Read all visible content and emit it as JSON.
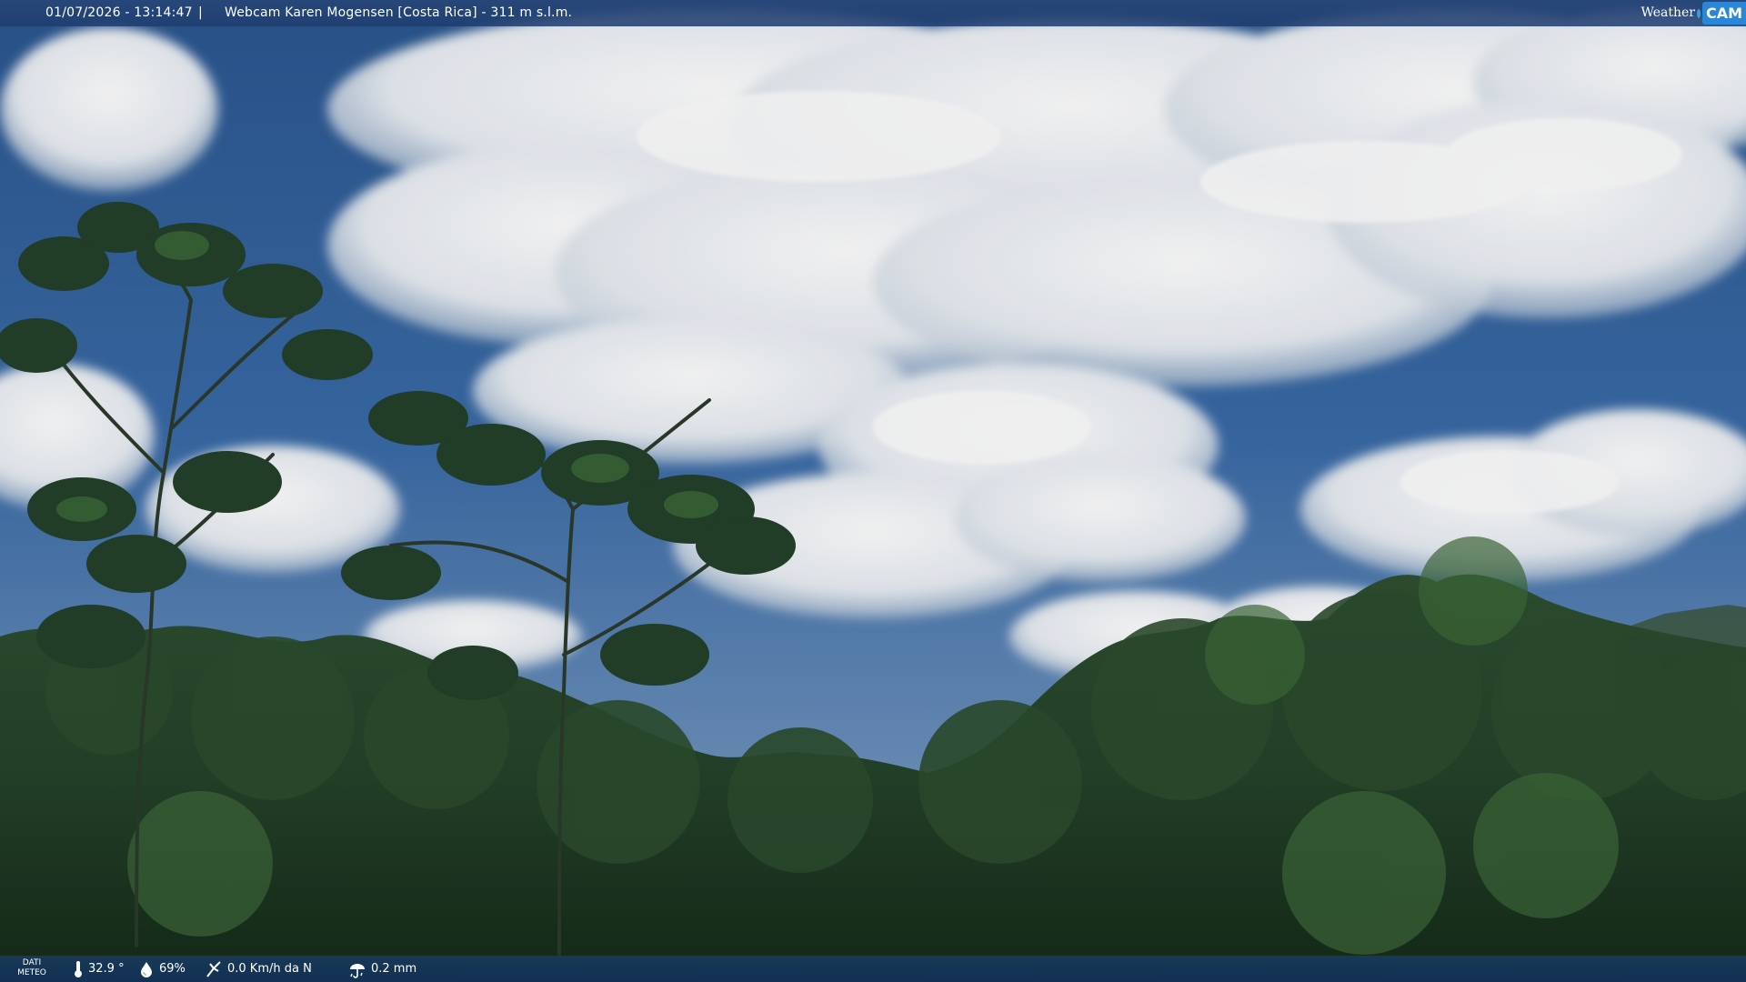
{
  "header": {
    "datetime": "01/07/2026 - 13:14:47",
    "separator": "|",
    "caption": "Webcam Karen Mogensen [Costa Rica] - 311 m s.l.m."
  },
  "logo": {
    "word": "Weather",
    "cam": "CAM"
  },
  "footer": {
    "label_line1": "DATI",
    "label_line2": "METEO",
    "temperature": "32.9 °",
    "humidity": "69%",
    "wind": "0.0 Km/h da N",
    "rain": "0.2 mm",
    "icons": {
      "temperature": "thermometer-icon",
      "humidity": "humidity-drop-icon",
      "wind": "wind-icon",
      "rain": "rain-icon"
    }
  },
  "colors": {
    "sky": "#2f5f9e",
    "cloud": "#f2f5f8",
    "foliage": "#1f3a1f",
    "bar": "#1e4477",
    "logo_accent": "#2a86d6"
  }
}
